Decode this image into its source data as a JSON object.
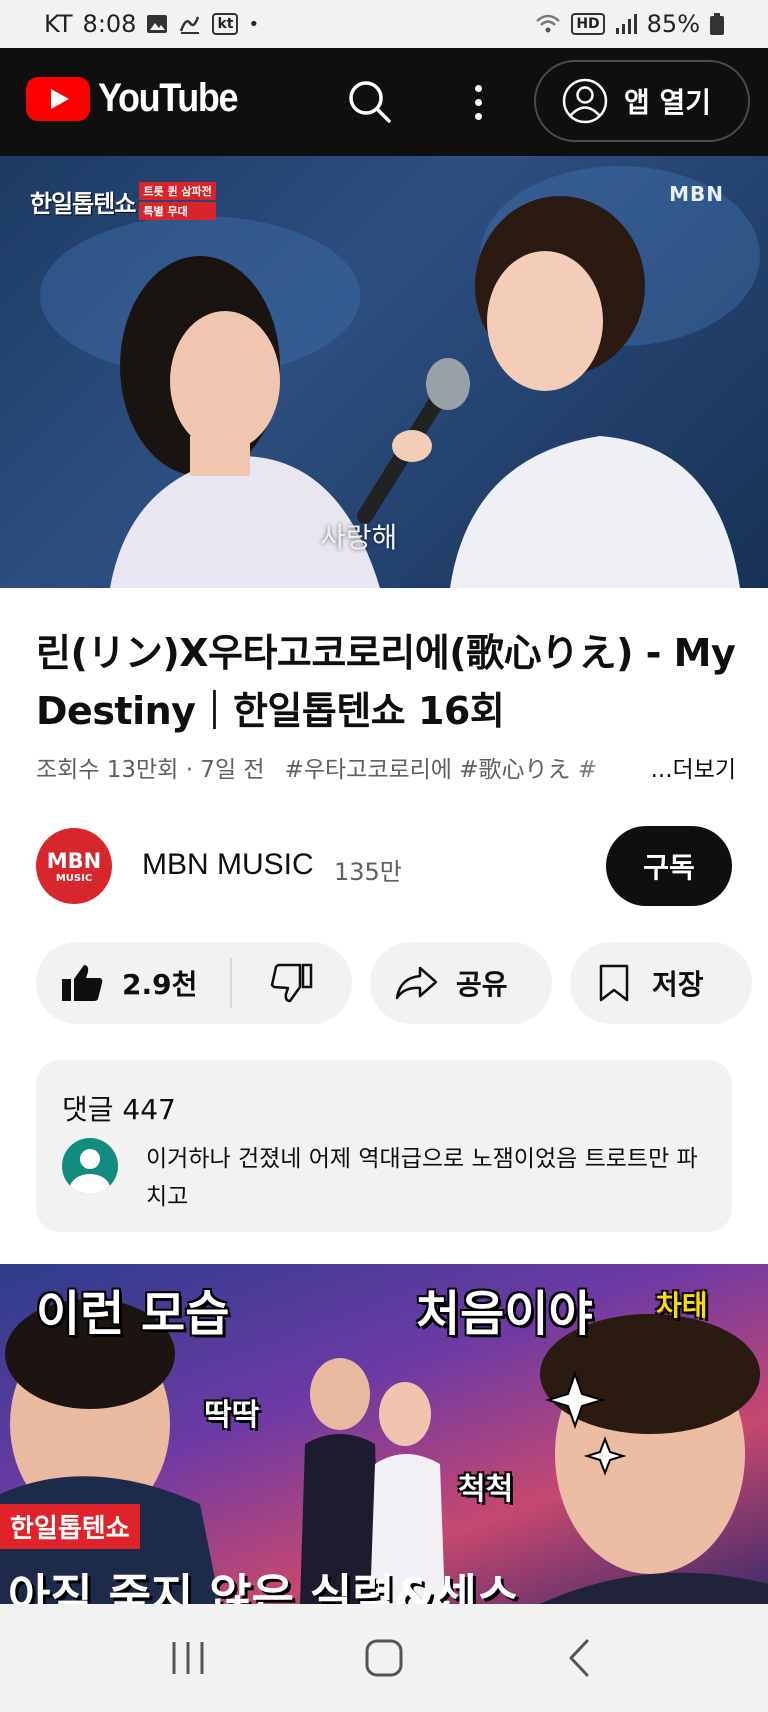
{
  "status_bar": {
    "carrier": "KT",
    "time": "8:08",
    "kt_badge": "kt",
    "hd_badge": "HD",
    "battery": "85%"
  },
  "app_bar": {
    "logo_text": "YouTube",
    "open_app_label": "앱 열기"
  },
  "video": {
    "show_badge": "한일톱텐쇼",
    "badge_line1": "트롯 퀸 삼파전",
    "badge_line2": "특별 무대",
    "broadcaster": "MBN",
    "caption": "사랑해"
  },
  "title": {
    "text": "린(リン)X우타고코로리에(歌心りえ) - My Destiny｜한일톱텐쇼 16회"
  },
  "meta": {
    "views_time": "조회수 13만회 · 7일 전",
    "tags": "#우타고코로리에 #歌心りえ #",
    "more_label": "...더보기"
  },
  "channel": {
    "avatar_big": "MBN",
    "avatar_small": "MUSIC",
    "name": "MBN MUSIC",
    "subscribers": "135만",
    "subscribe_label": "구독"
  },
  "actions": {
    "like_count": "2.9천",
    "share_label": "공유",
    "save_label": "저장"
  },
  "comments": {
    "title": "댓글 447",
    "top_comment": "이거하나 건졌네 어제 역대급으로 노잼이었음 트로트만 파치고"
  },
  "next_video": {
    "text1": "이런 모습",
    "text2": "처음이야",
    "text3": "딱딱",
    "text4": "척척",
    "text5": "차태",
    "badge": "한일톱텐쇼",
    "bottom_text": "아직 죽지 않은 실력&센스"
  },
  "colors": {
    "brand_red": "#ff0000",
    "appbar_bg": "#0f0f0f",
    "pill_bg": "#f2f2f2",
    "mbn_red": "#d7262c"
  }
}
